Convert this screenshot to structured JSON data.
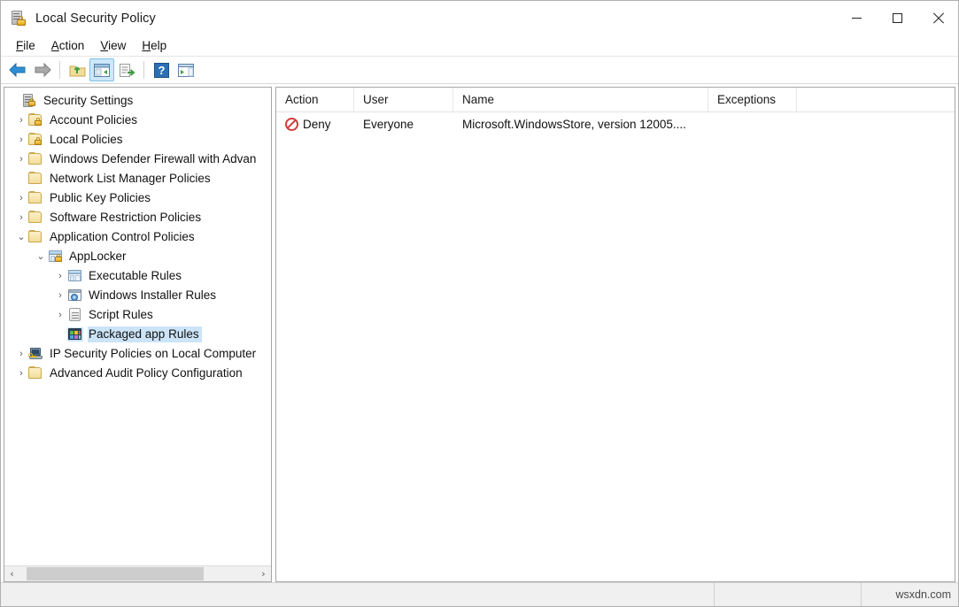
{
  "window": {
    "title": "Local Security Policy",
    "title_icon": "security-policy-icon",
    "controls": {
      "minimize": "minimize-icon",
      "maximize": "maximize-icon",
      "close": "close-icon"
    }
  },
  "menubar": {
    "items": [
      {
        "label": "File",
        "accel": "F"
      },
      {
        "label": "Action",
        "accel": "A"
      },
      {
        "label": "View",
        "accel": "V"
      },
      {
        "label": "Help",
        "accel": "H"
      }
    ]
  },
  "toolbar": {
    "buttons": [
      {
        "name": "back-arrow-icon",
        "label": "Back"
      },
      {
        "name": "forward-arrow-icon",
        "label": "Forward"
      },
      {
        "name": "up-one-level-icon",
        "label": "Up One Level"
      },
      {
        "name": "show-hide-tree-icon",
        "label": "Show/Hide Console Tree",
        "active": true
      },
      {
        "name": "export-list-icon",
        "label": "Export List"
      },
      {
        "name": "help-icon",
        "label": "Help"
      },
      {
        "name": "show-action-pane-icon",
        "label": "Show/Hide Action Pane"
      }
    ]
  },
  "tree": {
    "nodes": [
      {
        "label": "Security Settings",
        "icon": "server-lock-icon",
        "indent": 0,
        "twist": "",
        "selected": false
      },
      {
        "label": "Account Policies",
        "icon": "folder-lock-icon",
        "indent": 1,
        "twist": "›",
        "selected": false
      },
      {
        "label": "Local Policies",
        "icon": "folder-lock-icon",
        "indent": 1,
        "twist": "›",
        "selected": false
      },
      {
        "label": "Windows Defender Firewall with Advan",
        "icon": "folder-icon",
        "indent": 1,
        "twist": "›",
        "selected": false
      },
      {
        "label": "Network List Manager Policies",
        "icon": "folder-icon",
        "indent": 1,
        "twist": "",
        "selected": false
      },
      {
        "label": "Public Key Policies",
        "icon": "folder-icon",
        "indent": 1,
        "twist": "›",
        "selected": false
      },
      {
        "label": "Software Restriction Policies",
        "icon": "folder-icon",
        "indent": 1,
        "twist": "›",
        "selected": false
      },
      {
        "label": "Application Control Policies",
        "icon": "folder-icon",
        "indent": 1,
        "twist": "⌄",
        "selected": false
      },
      {
        "label": "AppLocker",
        "icon": "applocker-icon",
        "indent": 2,
        "twist": "⌄",
        "selected": false
      },
      {
        "label": "Executable Rules",
        "icon": "window-icon",
        "indent": 3,
        "twist": "›",
        "selected": false
      },
      {
        "label": "Windows Installer Rules",
        "icon": "disc-icon",
        "indent": 3,
        "twist": "›",
        "selected": false
      },
      {
        "label": "Script Rules",
        "icon": "script-icon",
        "indent": 3,
        "twist": "›",
        "selected": false
      },
      {
        "label": "Packaged app Rules",
        "icon": "packaged-app-icon",
        "indent": 3,
        "twist": "",
        "selected": true
      },
      {
        "label": "IP Security Policies on Local Computer",
        "icon": "computer-key-icon",
        "indent": 1,
        "twist": "›",
        "selected": false
      },
      {
        "label": "Advanced Audit Policy Configuration",
        "icon": "folder-icon",
        "indent": 1,
        "twist": "›",
        "selected": false
      }
    ],
    "scrollbar": {
      "left_arrow": "‹",
      "right_arrow": "›"
    }
  },
  "list": {
    "columns": [
      "Action",
      "User",
      "Name",
      "Exceptions"
    ],
    "rows": [
      {
        "action_icon": "deny-icon",
        "action": "Deny",
        "user": "Everyone",
        "name": "Microsoft.WindowsStore, version 12005....",
        "exceptions": ""
      }
    ]
  },
  "statusbar": {
    "left": "",
    "middle": "",
    "right": "wsxdn.com"
  },
  "colors": {
    "selection": "#cce4f7",
    "deny_red": "#d13b3b",
    "toolbar_active": "#cde8fa",
    "folder_gold": "#f2dd9a"
  }
}
